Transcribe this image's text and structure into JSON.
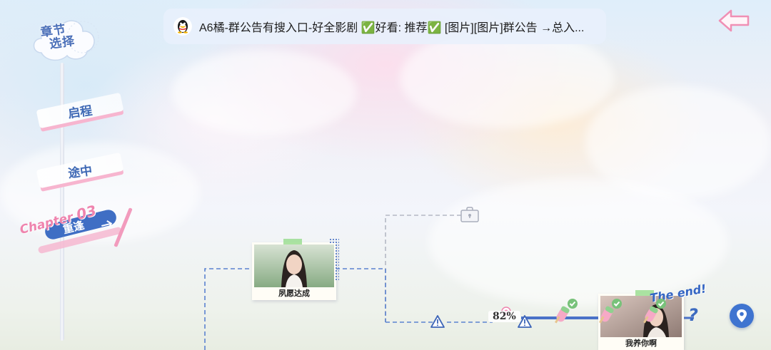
{
  "header": {
    "badge_line1": "章节",
    "badge_line2": "选择",
    "back_icon": "back-arrow-icon"
  },
  "announcement": {
    "icon": "qq-penguin-icon",
    "text": "A6橘-群公告有搜入口-好全影剧 ✅好看: 推荐✅ [图片][图片]群公告 →总入..."
  },
  "chapters": [
    {
      "label": "启程"
    },
    {
      "label": "途中"
    },
    {
      "prefix": "Chapter",
      "number": "03",
      "label": "重逢",
      "selected": true
    }
  ],
  "story_nodes": [
    {
      "caption": "夙愿达成",
      "state": "unlocked"
    },
    {
      "caption": "我养你啊",
      "state": "unlocked",
      "ending": "The end!"
    }
  ],
  "progress": {
    "percent_label": "82%",
    "value": 0.82
  },
  "controls": {
    "unknown_node": "?",
    "locate_icon": "map-pin-icon"
  },
  "colors": {
    "accent_blue": "#3f6ec4",
    "accent_pink": "#ef84ae",
    "line_blue": "#5b82d0",
    "line_gray": "#b4b8c4"
  }
}
